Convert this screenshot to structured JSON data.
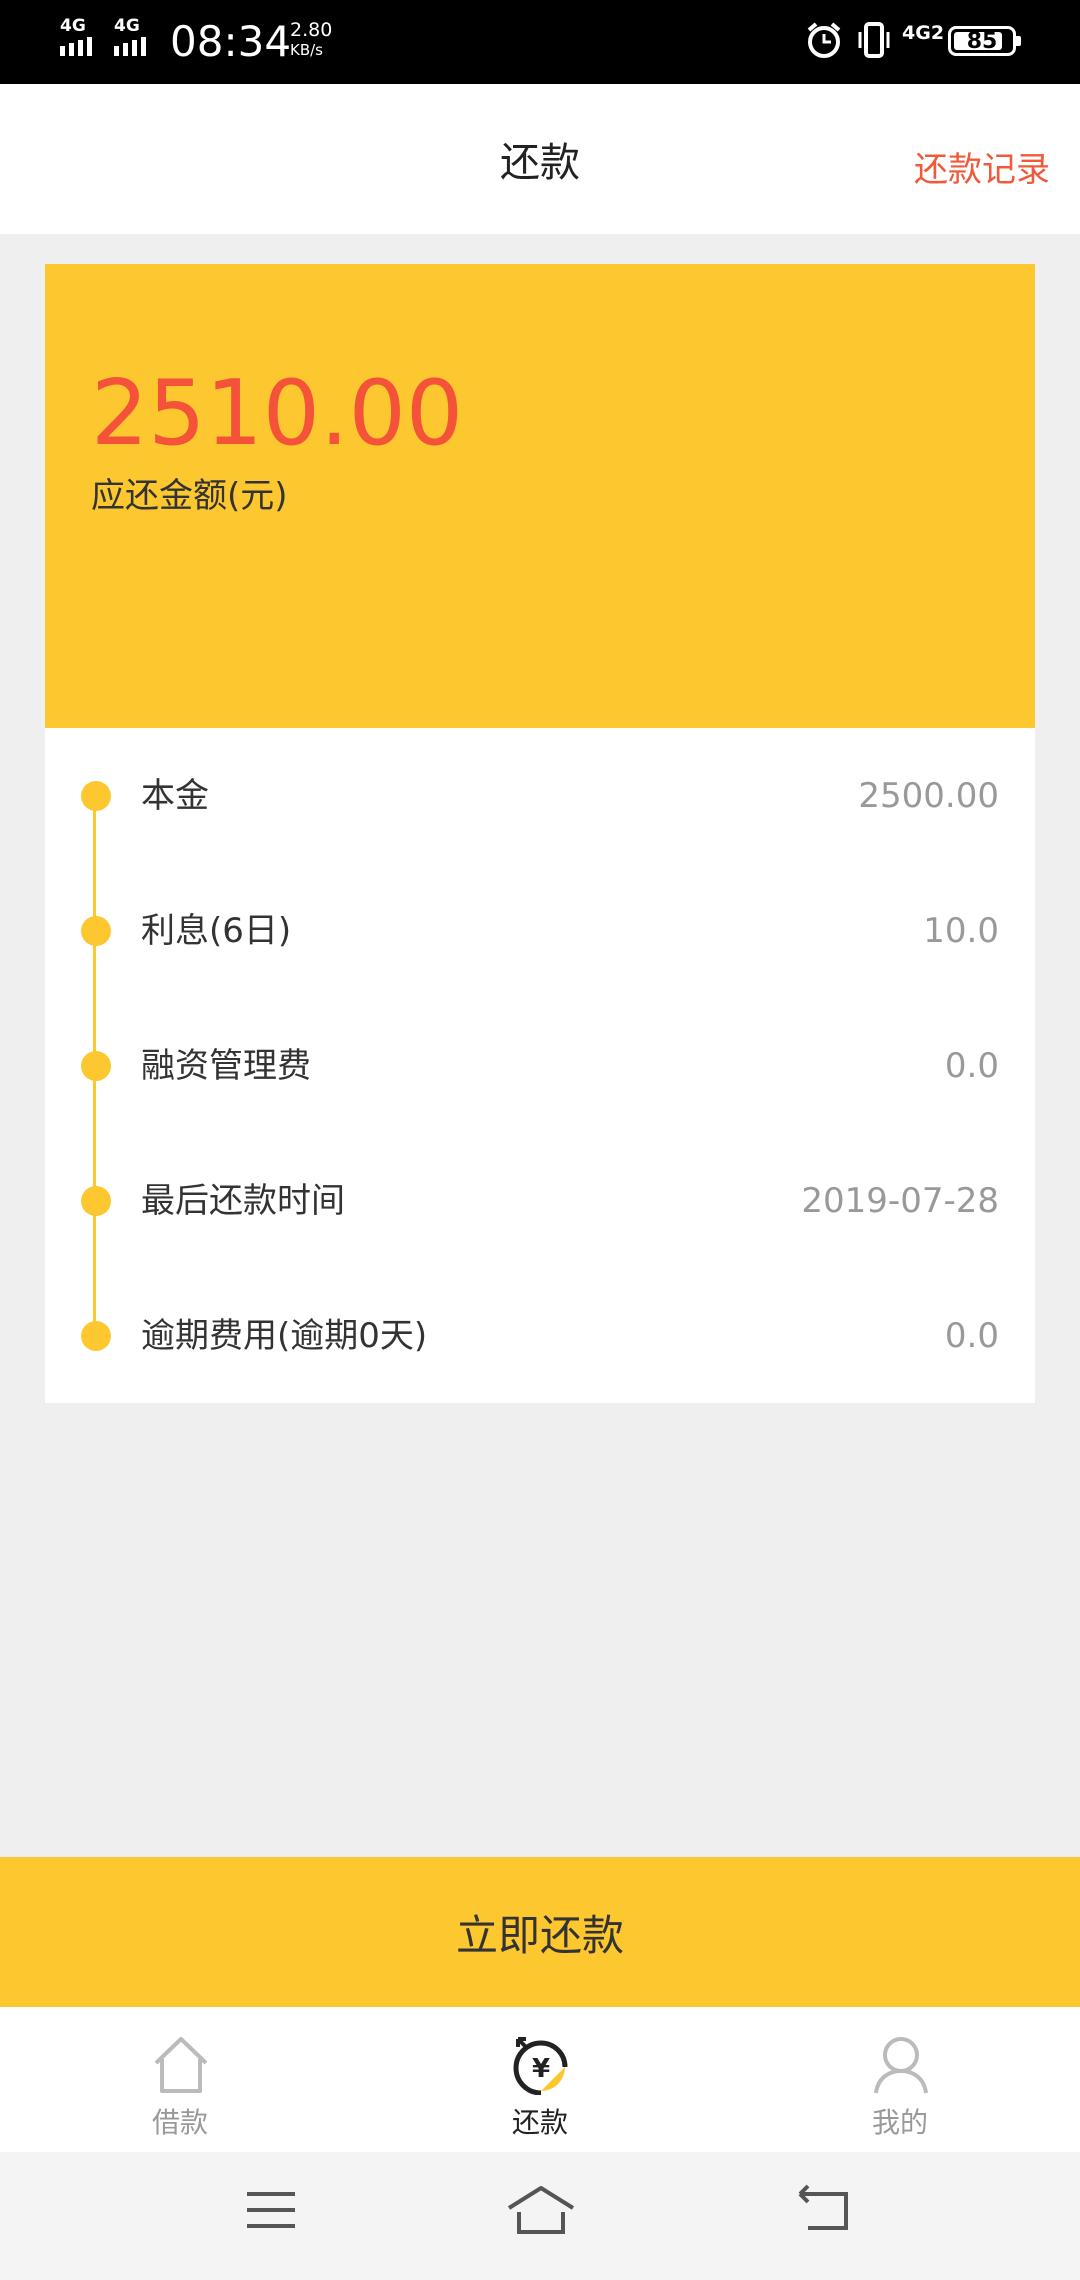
{
  "status_bar": {
    "network_1": "4G",
    "network_2": "4G",
    "time": "08:34",
    "speed_value": "2.80",
    "speed_unit": "KB/s",
    "network_3": "4G2",
    "battery": "85",
    "battery_level": 0.85,
    "icons": [
      "signal-icon",
      "alarm-icon",
      "vibrate-icon",
      "battery-icon"
    ]
  },
  "header": {
    "title": "还款",
    "record_link": "还款记录"
  },
  "summary": {
    "amount": "2510.00",
    "amount_label": "应还金额(元)"
  },
  "details": [
    {
      "label": "本金",
      "value": "2500.00"
    },
    {
      "label": "利息(6日)",
      "value": "10.0"
    },
    {
      "label": "融资管理费",
      "value": "0.0"
    },
    {
      "label": "最后还款时间",
      "value": "2019-07-28"
    },
    {
      "label": "逾期费用(逾期0天)",
      "value": "0.0"
    }
  ],
  "pay_button": "立即还款",
  "tabs": [
    {
      "label": "借款",
      "icon": "home-icon",
      "active": false
    },
    {
      "label": "还款",
      "icon": "repay-yen-icon",
      "active": true
    },
    {
      "label": "我的",
      "icon": "user-icon",
      "active": false
    }
  ],
  "system_nav": [
    "menu-icon",
    "home-icon",
    "back-icon"
  ],
  "colors": {
    "accent": "#fdc82f",
    "amount": "#f5523a",
    "link": "#f05a3b",
    "background": "#efefef"
  }
}
